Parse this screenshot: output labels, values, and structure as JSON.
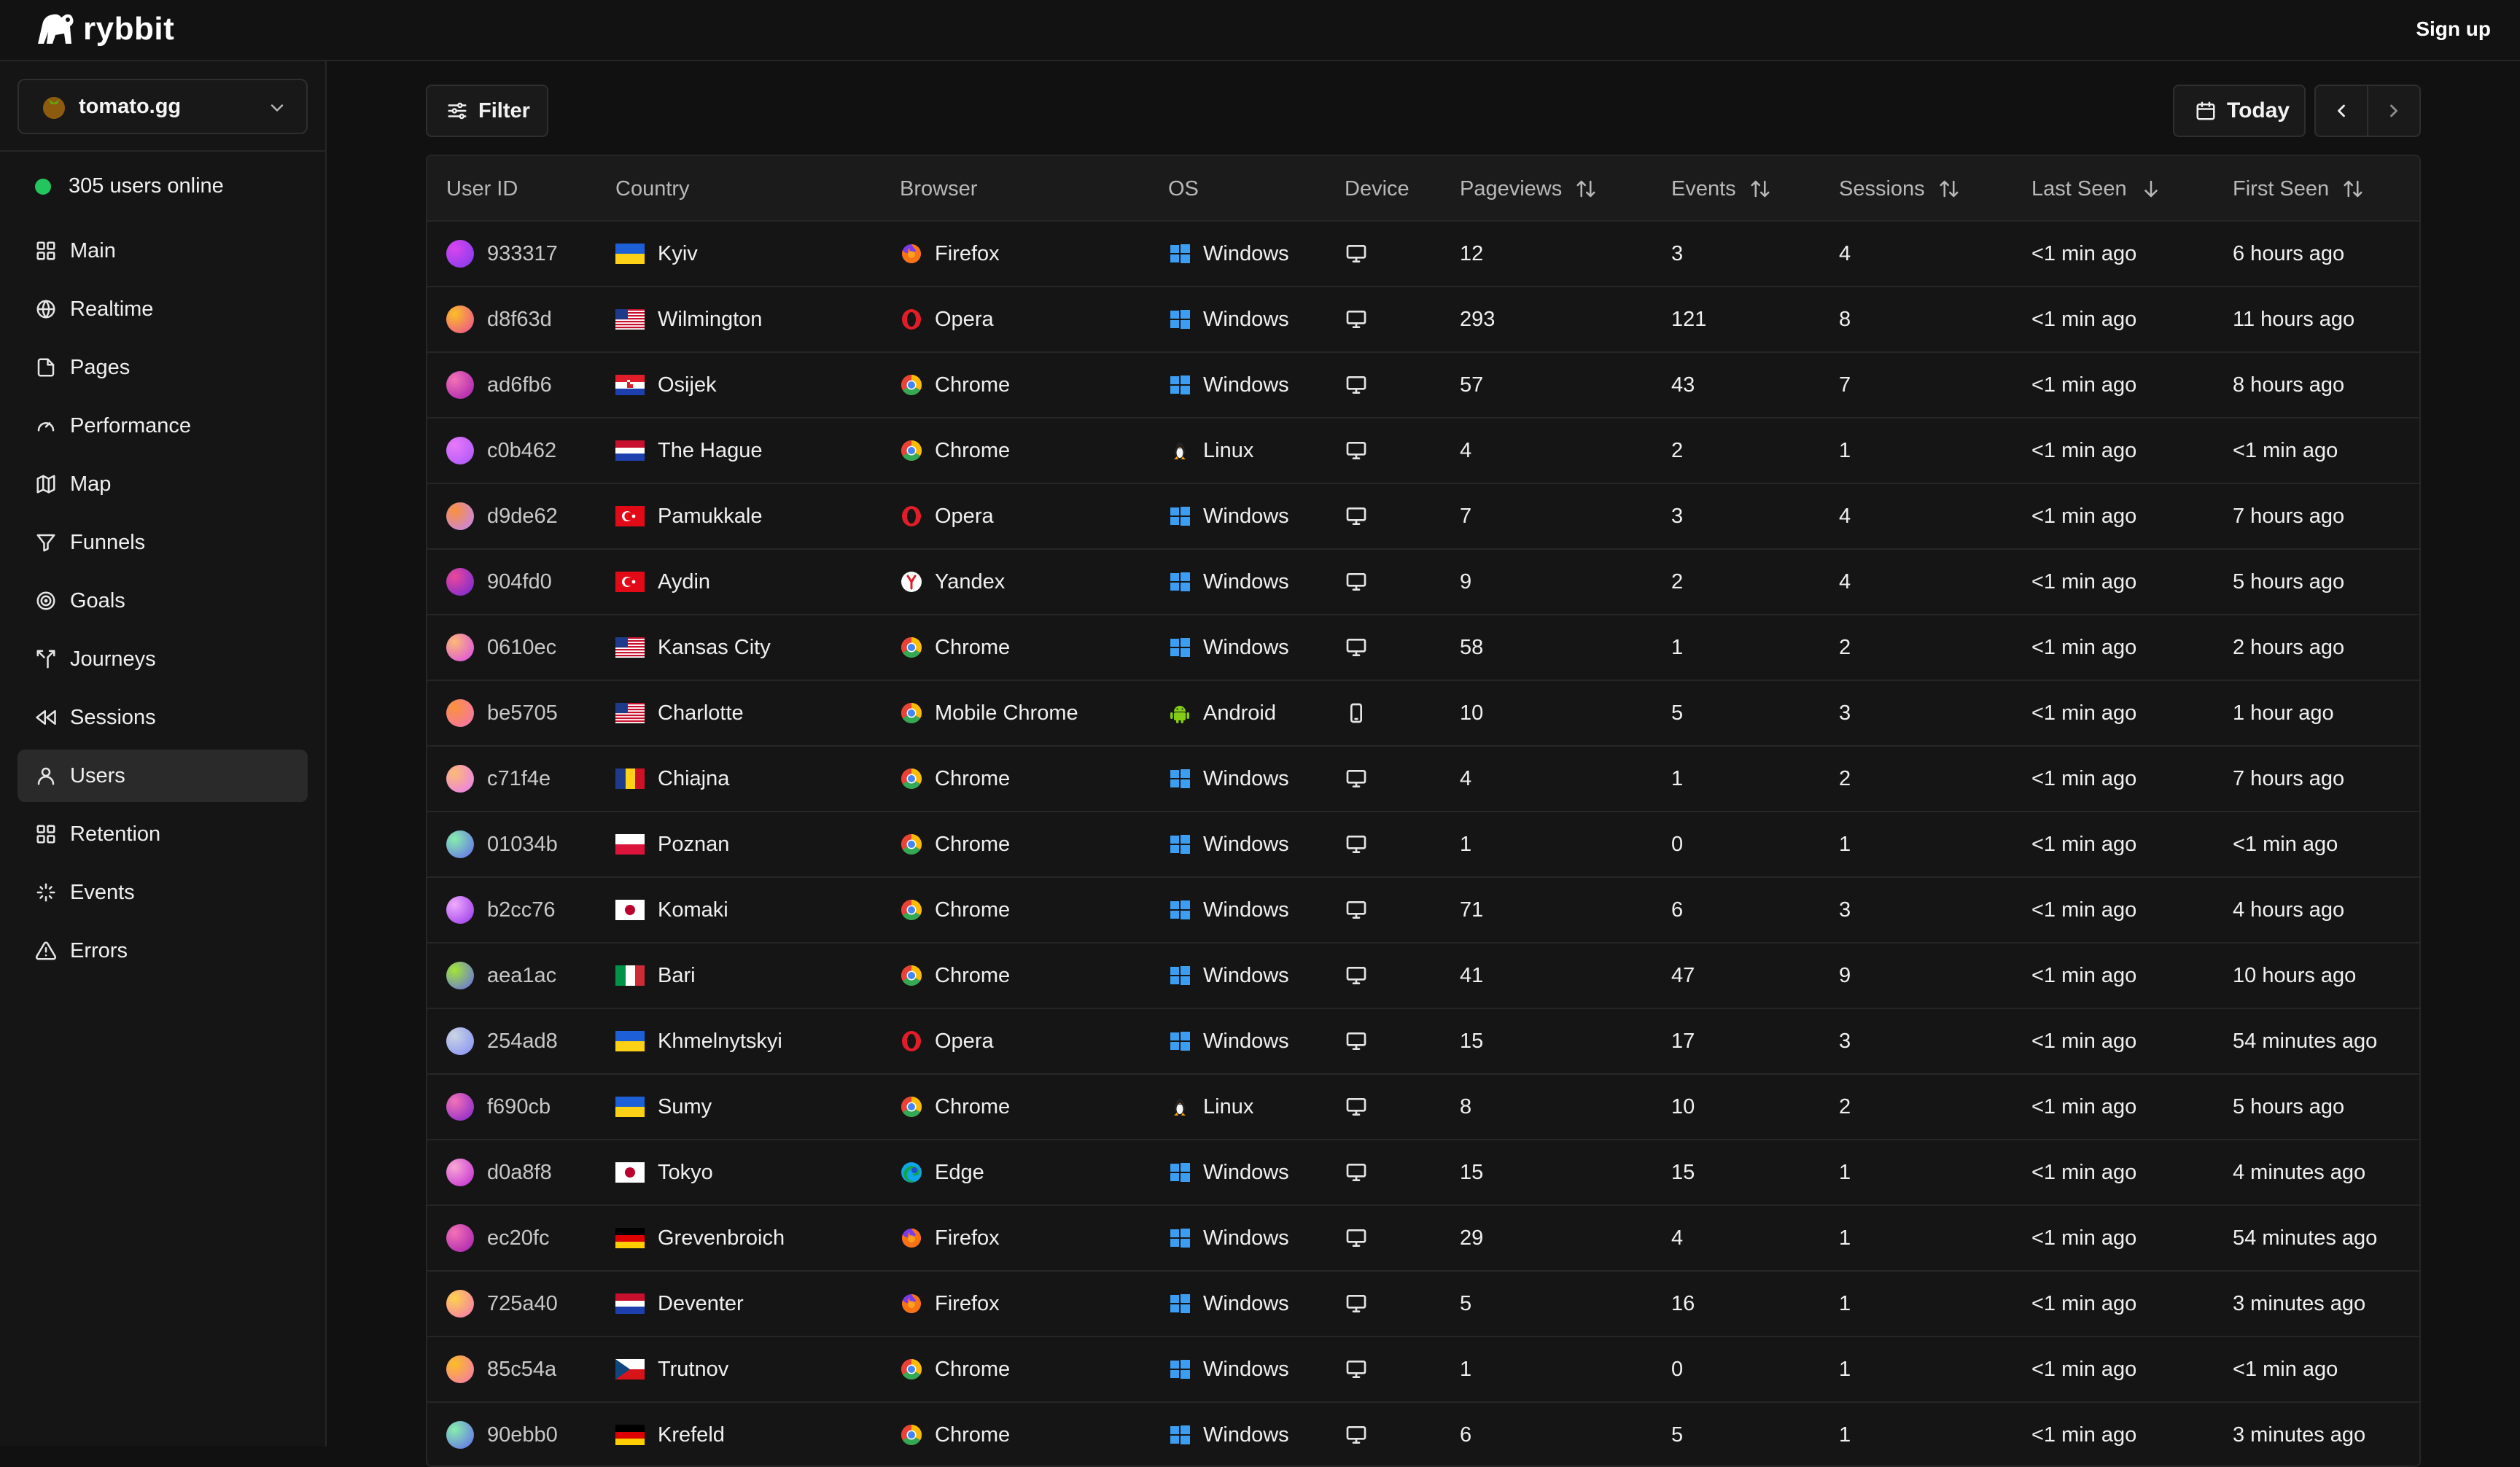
{
  "app": {
    "name": "rybbit",
    "signup_label": "Sign up"
  },
  "site": {
    "name": "tomato.gg"
  },
  "sidebar": {
    "online_text": "305 users online",
    "items": [
      {
        "label": "Main",
        "icon": "grid-icon"
      },
      {
        "label": "Realtime",
        "icon": "globe-icon"
      },
      {
        "label": "Pages",
        "icon": "file-icon"
      },
      {
        "label": "Performance",
        "icon": "gauge-icon"
      },
      {
        "label": "Map",
        "icon": "map-icon"
      },
      {
        "label": "Funnels",
        "icon": "funnel-icon"
      },
      {
        "label": "Goals",
        "icon": "target-icon"
      },
      {
        "label": "Journeys",
        "icon": "split-icon"
      },
      {
        "label": "Sessions",
        "icon": "rewind-icon"
      },
      {
        "label": "Users",
        "icon": "user-icon",
        "active": true
      },
      {
        "label": "Retention",
        "icon": "grid-icon"
      },
      {
        "label": "Events",
        "icon": "sparkle-icon"
      },
      {
        "label": "Errors",
        "icon": "alert-triangle-icon"
      }
    ]
  },
  "toolbar": {
    "filter_label": "Filter",
    "date_label": "Today"
  },
  "table": {
    "headers": {
      "user_id": "User ID",
      "country": "Country",
      "browser": "Browser",
      "os": "OS",
      "device": "Device",
      "pageviews": "Pageviews",
      "events": "Events",
      "sessions": "Sessions",
      "last_seen": "Last Seen",
      "first_seen": "First Seen"
    },
    "rows": [
      {
        "id": "933317",
        "city": "Kyiv",
        "flag": "UA",
        "browser": "Firefox",
        "os": "Windows",
        "device": "desktop",
        "pageviews": "12",
        "events": "3",
        "sessions": "4",
        "last": "<1 min ago",
        "first": "6 hours ago",
        "avatar": [
          "#d946ef",
          "#7c3aed"
        ]
      },
      {
        "id": "d8f63d",
        "city": "Wilmington",
        "flag": "US",
        "browser": "Opera",
        "os": "Windows",
        "device": "desktop",
        "pageviews": "293",
        "events": "121",
        "sessions": "8",
        "last": "<1 min ago",
        "first": "11 hours ago",
        "avatar": [
          "#fbbf24",
          "#ec4899"
        ]
      },
      {
        "id": "ad6fb6",
        "city": "Osijek",
        "flag": "HR",
        "browser": "Chrome",
        "os": "Windows",
        "device": "desktop",
        "pageviews": "57",
        "events": "43",
        "sessions": "7",
        "last": "<1 min ago",
        "first": "8 hours ago",
        "avatar": [
          "#f472b6",
          "#a21caf"
        ]
      },
      {
        "id": "c0b462",
        "city": "The Hague",
        "flag": "NL",
        "browser": "Chrome",
        "os": "Linux",
        "device": "desktop",
        "pageviews": "4",
        "events": "2",
        "sessions": "1",
        "last": "<1 min ago",
        "first": "<1 min ago",
        "avatar": [
          "#e879f9",
          "#a855f7"
        ]
      },
      {
        "id": "d9de62",
        "city": "Pamukkale",
        "flag": "TR",
        "browser": "Opera",
        "os": "Windows",
        "device": "desktop",
        "pageviews": "7",
        "events": "3",
        "sessions": "4",
        "last": "<1 min ago",
        "first": "7 hours ago",
        "avatar": [
          "#fb923c",
          "#c084fc"
        ]
      },
      {
        "id": "904fd0",
        "city": "Aydin",
        "flag": "TR",
        "browser": "Yandex",
        "os": "Windows",
        "device": "desktop",
        "pageviews": "9",
        "events": "2",
        "sessions": "4",
        "last": "<1 min ago",
        "first": "5 hours ago",
        "avatar": [
          "#ec4899",
          "#6d28d9"
        ]
      },
      {
        "id": "0610ec",
        "city": "Kansas City",
        "flag": "US",
        "browser": "Chrome",
        "os": "Windows",
        "device": "desktop",
        "pageviews": "58",
        "events": "1",
        "sessions": "2",
        "last": "<1 min ago",
        "first": "2 hours ago",
        "avatar": [
          "#fdba74",
          "#d946ef"
        ]
      },
      {
        "id": "be5705",
        "city": "Charlotte",
        "flag": "US",
        "browser": "Mobile Chrome",
        "os": "Android",
        "device": "mobile",
        "pageviews": "10",
        "events": "5",
        "sessions": "3",
        "last": "<1 min ago",
        "first": "1 hour ago",
        "avatar": [
          "#fb923c",
          "#f472b6"
        ]
      },
      {
        "id": "c71f4e",
        "city": "Chiajna",
        "flag": "RO",
        "browser": "Chrome",
        "os": "Windows",
        "device": "desktop",
        "pageviews": "4",
        "events": "1",
        "sessions": "2",
        "last": "<1 min ago",
        "first": "7 hours ago",
        "avatar": [
          "#fdba74",
          "#e879f9"
        ]
      },
      {
        "id": "01034b",
        "city": "Poznan",
        "flag": "PL",
        "browser": "Chrome",
        "os": "Windows",
        "device": "desktop",
        "pageviews": "1",
        "events": "0",
        "sessions": "1",
        "last": "<1 min ago",
        "first": "<1 min ago",
        "avatar": [
          "#86efac",
          "#6366f1"
        ]
      },
      {
        "id": "b2cc76",
        "city": "Komaki",
        "flag": "JP",
        "browser": "Chrome",
        "os": "Windows",
        "device": "desktop",
        "pageviews": "71",
        "events": "6",
        "sessions": "3",
        "last": "<1 min ago",
        "first": "4 hours ago",
        "avatar": [
          "#f0abfc",
          "#9333ea"
        ]
      },
      {
        "id": "aea1ac",
        "city": "Bari",
        "flag": "IT",
        "browser": "Chrome",
        "os": "Windows",
        "device": "desktop",
        "pageviews": "41",
        "events": "47",
        "sessions": "9",
        "last": "<1 min ago",
        "first": "10 hours ago",
        "avatar": [
          "#a3e635",
          "#6366f1"
        ]
      },
      {
        "id": "254ad8",
        "city": "Khmelnytskyi",
        "flag": "UA",
        "browser": "Opera",
        "os": "Windows",
        "device": "desktop",
        "pageviews": "15",
        "events": "17",
        "sessions": "3",
        "last": "<1 min ago",
        "first": "54 minutes ago",
        "avatar": [
          "#cbd5e1",
          "#818cf8"
        ]
      },
      {
        "id": "f690cb",
        "city": "Sumy",
        "flag": "UA",
        "browser": "Chrome",
        "os": "Linux",
        "device": "desktop",
        "pageviews": "8",
        "events": "10",
        "sessions": "2",
        "last": "<1 min ago",
        "first": "5 hours ago",
        "avatar": [
          "#f472b6",
          "#7e22ce"
        ]
      },
      {
        "id": "d0a8f8",
        "city": "Tokyo",
        "flag": "JP",
        "browser": "Edge",
        "os": "Windows",
        "device": "desktop",
        "pageviews": "15",
        "events": "15",
        "sessions": "1",
        "last": "<1 min ago",
        "first": "4 minutes ago",
        "avatar": [
          "#f9a8d4",
          "#c026d3"
        ]
      },
      {
        "id": "ec20fc",
        "city": "Grevenbroich",
        "flag": "DE",
        "browser": "Firefox",
        "os": "Windows",
        "device": "desktop",
        "pageviews": "29",
        "events": "4",
        "sessions": "1",
        "last": "<1 min ago",
        "first": "54 minutes ago",
        "avatar": [
          "#f472b6",
          "#a21caf"
        ]
      },
      {
        "id": "725a40",
        "city": "Deventer",
        "flag": "NL",
        "browser": "Firefox",
        "os": "Windows",
        "device": "desktop",
        "pageviews": "5",
        "events": "16",
        "sessions": "1",
        "last": "<1 min ago",
        "first": "3 minutes ago",
        "avatar": [
          "#fcd34d",
          "#f472b6"
        ]
      },
      {
        "id": "85c54a",
        "city": "Trutnov",
        "flag": "CZ",
        "browser": "Chrome",
        "os": "Windows",
        "device": "desktop",
        "pageviews": "1",
        "events": "0",
        "sessions": "1",
        "last": "<1 min ago",
        "first": "<1 min ago",
        "avatar": [
          "#fbbf24",
          "#f472b6"
        ]
      },
      {
        "id": "90ebb0",
        "city": "Krefeld",
        "flag": "DE",
        "browser": "Chrome",
        "os": "Windows",
        "device": "desktop",
        "pageviews": "6",
        "events": "5",
        "sessions": "1",
        "last": "<1 min ago",
        "first": "3 minutes ago",
        "avatar": [
          "#86efac",
          "#6366f1"
        ]
      }
    ]
  },
  "colors": {
    "background": "#111111",
    "online": "#22c55e",
    "windows": "#3b9ef2"
  }
}
